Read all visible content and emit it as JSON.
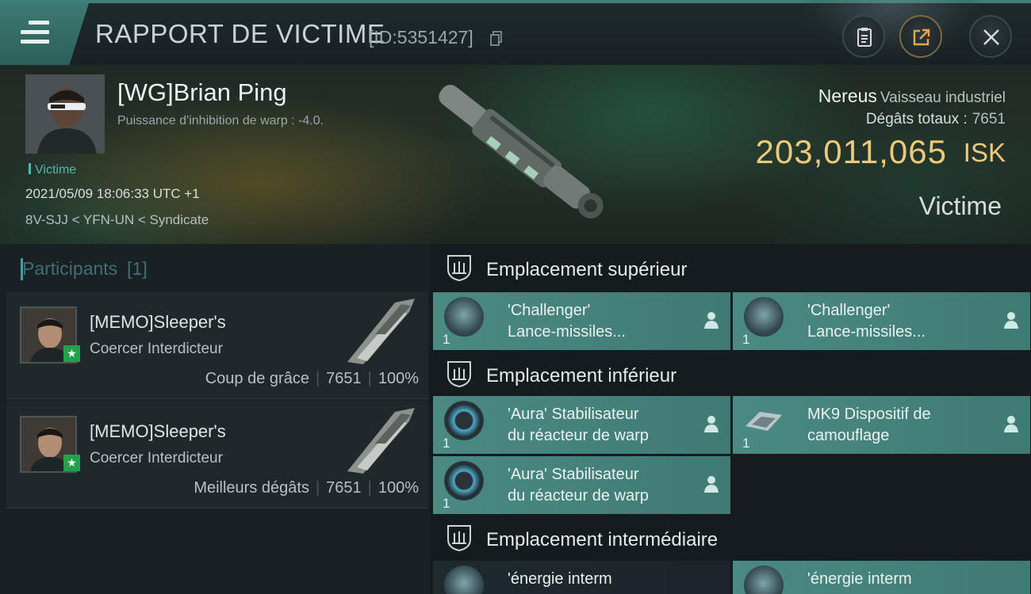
{
  "header": {
    "title": "RAPPORT DE VICTIME",
    "report_id": "[ID:5351427]",
    "menu_icon": "menu-icon",
    "actions": [
      "clipboard-icon",
      "share-icon",
      "close-icon"
    ]
  },
  "victim": {
    "name": "[WG]Brian Ping",
    "warp_disruption": "Puissance d'inhibition de warp : -4.0.",
    "tag": "Victime",
    "datetime": "2021/05/09 18:06:33 UTC +1",
    "location": "8V-SJJ < YFN-UN < Syndicate",
    "ship_name": "Nereus",
    "ship_class": "Vaisseau industriel",
    "damage_label": "Dégâts totaux :",
    "damage_value": "7651",
    "isk_value": "203,011,065",
    "isk_unit": "ISK",
    "role_label": "Victime"
  },
  "participants": {
    "title": "Participants",
    "count": "[1]",
    "items": [
      {
        "name": "[MEMO]Sleeper's",
        "ship": "Coercer Interdicteur",
        "role": "Coup de grâce",
        "damage": "7651",
        "percent": "100%"
      },
      {
        "name": "[MEMO]Sleeper's",
        "ship": "Coercer Interdicteur",
        "role": "Meilleurs dégâts",
        "damage": "7651",
        "percent": "100%"
      }
    ]
  },
  "slots": {
    "high": {
      "label": "Emplacement supérieur",
      "modules": [
        {
          "line1": "'Challenger'",
          "line2": "Lance-missiles...",
          "qty": "1",
          "icon": "missile-launcher-icon"
        },
        {
          "line1": "'Challenger'",
          "line2": "Lance-missiles...",
          "qty": "1",
          "icon": "missile-launcher-icon"
        }
      ]
    },
    "low": {
      "label": "Emplacement inférieur",
      "modules": [
        {
          "line1": "'Aura' Stabilisateur",
          "line2": "du réacteur de warp",
          "qty": "1",
          "icon": "warp-stabilizer-icon"
        },
        {
          "line1": "MK9 Dispositif de",
          "line2": "camouflage",
          "qty": "1",
          "icon": "cloaking-device-icon"
        },
        {
          "line1": "'Aura' Stabilisateur",
          "line2": "du réacteur de warp",
          "qty": "1",
          "icon": "warp-stabilizer-icon"
        }
      ]
    },
    "mid": {
      "label": "Emplacement intermédiaire",
      "modules": [
        {
          "line1": "'énergie interm",
          "line2": "",
          "qty": "",
          "icon": "energy-module-icon"
        },
        {
          "line1": "'énergie interm",
          "line2": "",
          "qty": "",
          "icon": "energy-module-icon"
        }
      ]
    }
  },
  "colors": {
    "accent": "#4a8a82",
    "isk_gold": "#f0c87a",
    "victim_teal": "#4fb7ad",
    "final_blow_green": "#21a34b"
  }
}
